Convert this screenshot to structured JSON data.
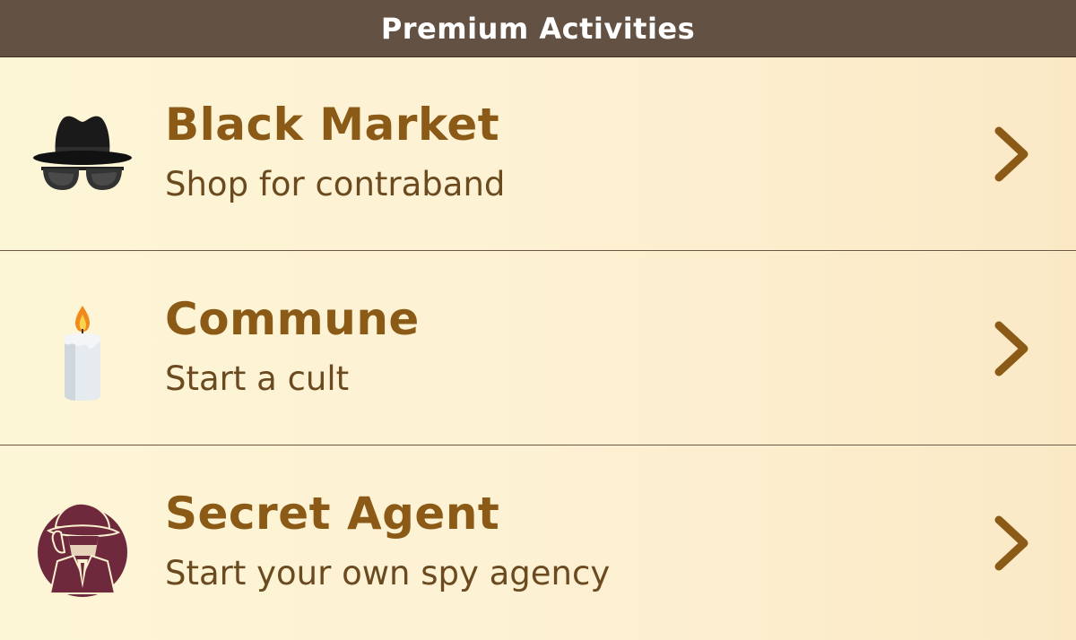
{
  "header": {
    "title": "Premium Activities"
  },
  "items": [
    {
      "title": "Black Market",
      "subtitle": "Shop for contraband",
      "icon": "spy-hat-sunglasses-icon"
    },
    {
      "title": "Commune",
      "subtitle": "Start a cult",
      "icon": "candle-icon"
    },
    {
      "title": "Secret Agent",
      "subtitle": "Start your own spy agency",
      "icon": "secret-agent-icon"
    }
  ],
  "colors": {
    "header_bg": "#635243",
    "title": "#8b5a16",
    "subtitle": "#6b4a20",
    "chevron": "#8b5a16",
    "agent_icon": "#6e2a3c"
  }
}
